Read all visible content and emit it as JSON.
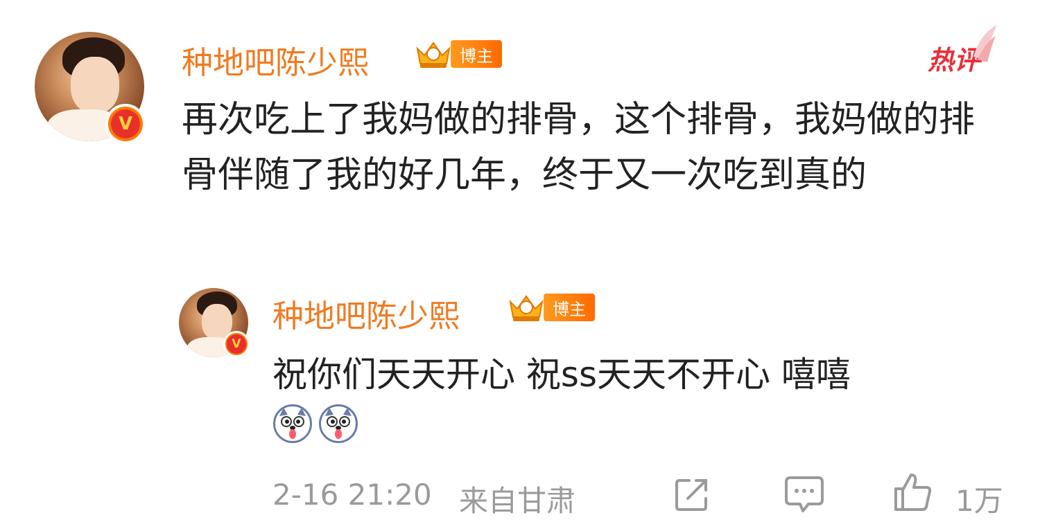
{
  "comment": {
    "username": "种地吧陈少熙",
    "badge_label": "博主",
    "hot_label": "热评",
    "text": "再次吃上了我妈做的排骨，这个排骨，我妈做的排骨伴随了我的好几年，终于又一次吃到真的"
  },
  "reply": {
    "username": "种地吧陈少熙",
    "badge_label": "博主",
    "text": "祝你们天天开心 祝ss天天不开心 嘻嘻"
  },
  "footer": {
    "time": "2-16 21:20",
    "location": "来自甘肃",
    "likes": "1万"
  },
  "icons": {
    "verified": "verified-v-icon",
    "crown": "crown-icon",
    "share": "share-icon",
    "comment": "comment-icon",
    "like": "thumbs-up-icon",
    "emoji": "husky-emoji"
  },
  "colors": {
    "username": "#f07a1f",
    "hot": "#e8303b",
    "meta": "#9a9a9a",
    "text": "#222222"
  }
}
